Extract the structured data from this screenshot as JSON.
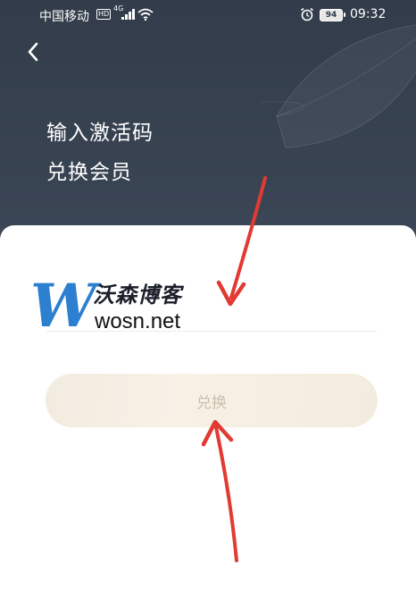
{
  "status_bar": {
    "carrier": "中国移动",
    "hd_badge": "HD",
    "network_type": "4G",
    "battery_level": "94",
    "time": "09:32"
  },
  "header": {
    "title_line1": "输入激活码",
    "title_line2": "兑换会员"
  },
  "form": {
    "code_input_value": "",
    "code_input_placeholder": "",
    "redeem_label": "兑换"
  },
  "watermark": {
    "letter": "W",
    "name": "沃森博客",
    "url": "wosn.net"
  },
  "colors": {
    "header_bg": "#3a4452",
    "button_bg": "#f3ecde",
    "button_text": "#cbbfae",
    "annotation_arrow": "#e23a33",
    "watermark_blue": "#2d7fd0"
  }
}
